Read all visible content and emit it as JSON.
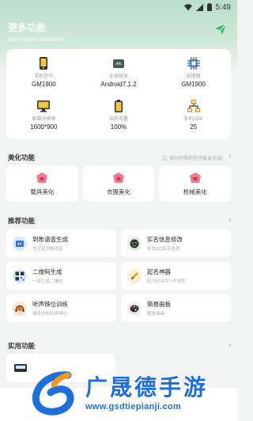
{
  "status_bar": {
    "time": "5:49"
  },
  "header": {
    "title": "更多功能",
    "subtitle": "More useful functions"
  },
  "device_info": [
    {
      "label": "手机型号",
      "value": "GM1900",
      "icon": "phone-icon"
    },
    {
      "label": "安卓版本",
      "value": "Android7.1.2",
      "icon": "android-icon"
    },
    {
      "label": "处理器",
      "value": "GM1900",
      "icon": "cpu-icon"
    },
    {
      "label": "屏幕分辨率",
      "value": "1600*900",
      "icon": "monitor-icon"
    },
    {
      "label": "当前电量",
      "value": "100%",
      "icon": "battery-icon"
    },
    {
      "label": "手机SDK",
      "value": "25",
      "icon": "network-icon"
    }
  ],
  "beauty": {
    "title": "美化功能",
    "note": "注: 部分特殊机型可能会无效!",
    "items": [
      {
        "label": "载具美化"
      },
      {
        "label": "衣服美化"
      },
      {
        "label": "枪械美化"
      }
    ]
  },
  "recommend": {
    "title": "推荐功能",
    "items": [
      {
        "title": "到账语音生成",
        "sub": "支付宝到账语音"
      },
      {
        "title": "实名信息修改",
        "sub": "修改QQ实名信息"
      },
      {
        "title": "二维码生成",
        "sub": "一键生成二维码"
      },
      {
        "title": "起名神器",
        "sub": "起个好名字? 不用愁"
      },
      {
        "title": "听声辨位训练",
        "sub": "锻炼你的听声辨位"
      },
      {
        "title": "简易画板",
        "sub": "随意画画~"
      }
    ]
  },
  "utility": {
    "title": "实用功能"
  },
  "watermark": {
    "brand": "广晟德手游",
    "url": "www.gsdtiepianji.com"
  },
  "colors": {
    "accent": "#3cb371",
    "header_bg": "#cfe9da",
    "watermark": "#1e6fd9"
  }
}
